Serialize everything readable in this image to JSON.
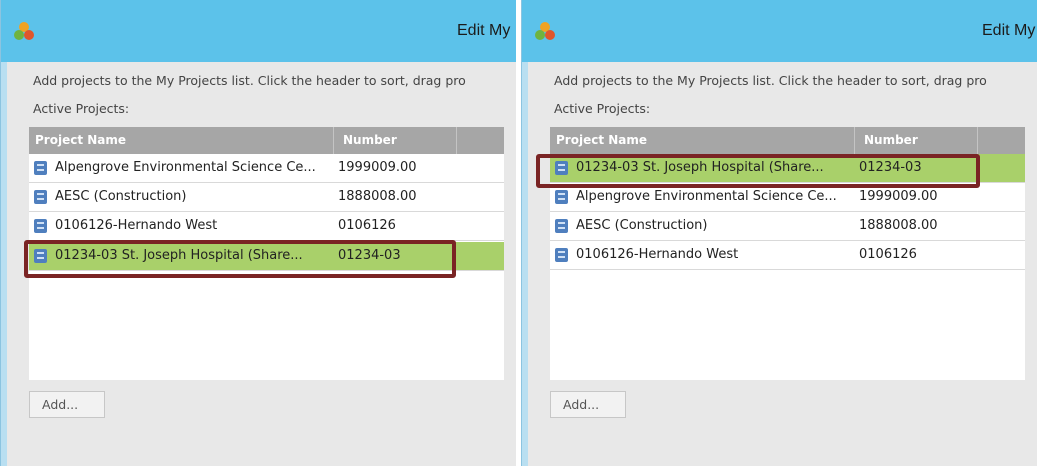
{
  "window": {
    "title": "Edit My",
    "instructions_left": "Add projects to the My Projects list. Click the header to sort, drag pro",
    "instructions_right": "Add projects to the My Projects list. Click the header to sort, drag pro",
    "active_label": "Active Projects:"
  },
  "columns": {
    "name": "Project Name",
    "number": "Number"
  },
  "left_rows": [
    {
      "name": "Alpengrove Environmental Science Ce...",
      "number": "1999009.00"
    },
    {
      "name": "AESC (Construction)",
      "number": "1888008.00"
    },
    {
      "name": "0106126-Hernando West",
      "number": "0106126"
    },
    {
      "name": "01234-03 St. Joseph Hospital (Share...",
      "number": "01234-03"
    }
  ],
  "right_rows": [
    {
      "name": "01234-03 St. Joseph Hospital (Share...",
      "number": "01234-03"
    },
    {
      "name": "Alpengrove Environmental Science Ce...",
      "number": "1999009.00"
    },
    {
      "name": "AESC (Construction)",
      "number": "1888008.00"
    },
    {
      "name": "0106126-Hernando West",
      "number": "0106126"
    }
  ],
  "add_button": "Add...",
  "colors": {
    "titlebar": "#5cc2ea",
    "selected_row": "#a9d06a",
    "highlight_border": "#7a2424",
    "header": "#a6a6a6"
  },
  "icons": {
    "app": "app-logo-icon",
    "row": "project-icon"
  }
}
